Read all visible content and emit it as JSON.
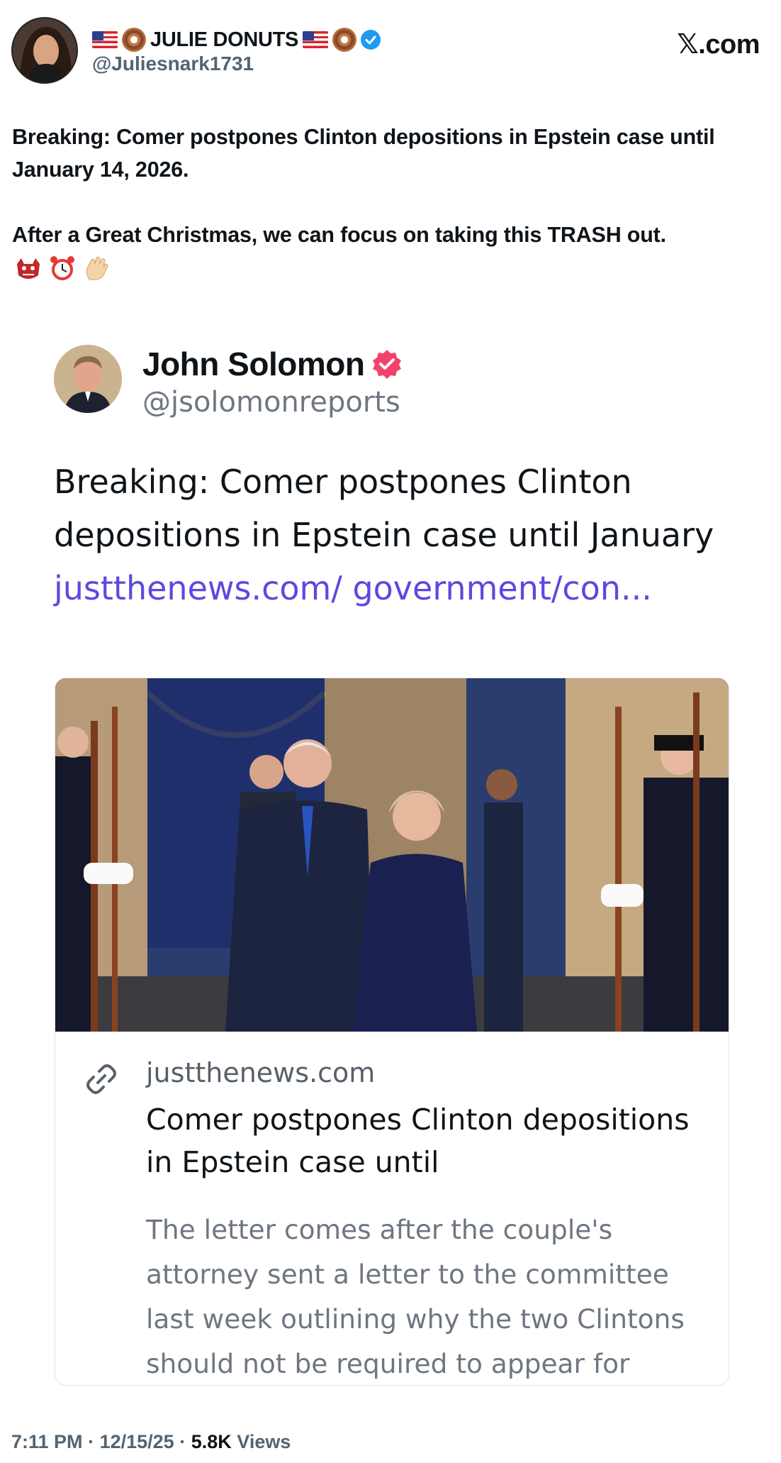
{
  "author": {
    "display_name": "JULIE DONUTS",
    "handle": "@Juliesnark1731",
    "verified": true,
    "name_decorations": [
      "us-flag-emoji",
      "donut-emoji"
    ]
  },
  "site_label": "𝕏.com",
  "tweet": {
    "line1": "Breaking: Comer postpones Clinton depositions in Epstein case until January 14, 2026.",
    "line2": "After a Great Christmas, we can focus on taking this TRASH out.",
    "emojis": [
      "goblin-face-emoji",
      "alarm-clock-emoji",
      "waving-hand-emoji"
    ]
  },
  "quoted": {
    "name": "John Solomon",
    "handle": "@jsolomonreports",
    "text": "Breaking: Comer postpones Clinton depositions in Epstein case until January",
    "link": "justthenews.com/ government/con...",
    "card": {
      "domain": "justthenews.com",
      "title": "Comer postpones Clinton depositions in Epstein case until",
      "description": "The letter comes after the couple's attorney sent a letter to the committee last week outlining why the two Clintons should not be required to appear for"
    }
  },
  "meta": {
    "time": "7:11 PM",
    "date": "12/15/25",
    "views_count": "5.8K",
    "views_label": "Views"
  },
  "colors": {
    "link": "#5b49e0",
    "verified_blue": "#1d9bf0",
    "verified_pink": "#f1416c",
    "secondary_text": "#536471"
  }
}
